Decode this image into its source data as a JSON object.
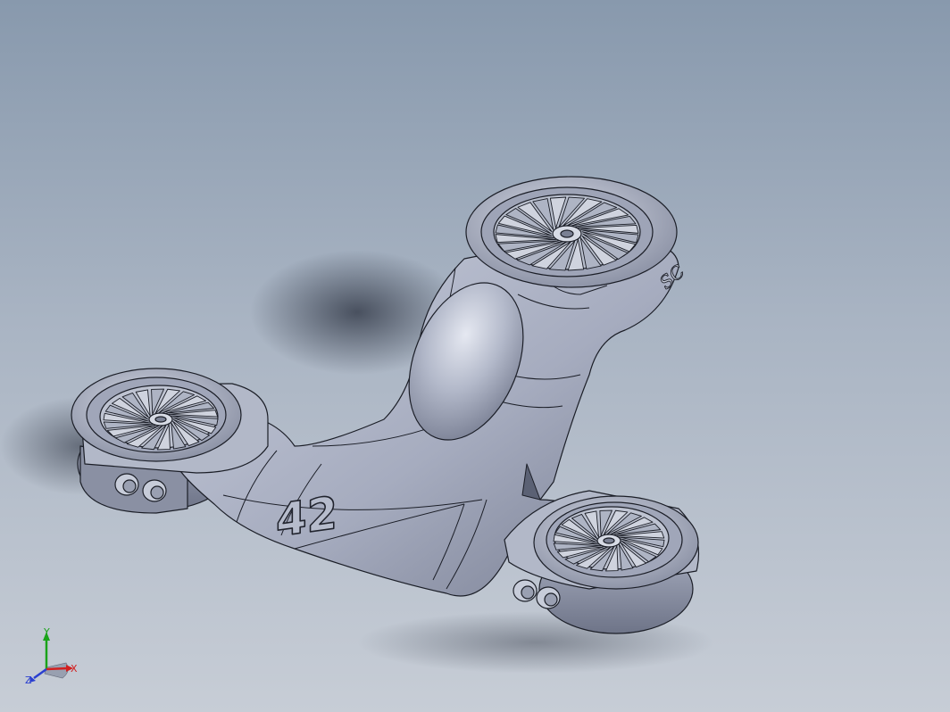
{
  "model": {
    "part_number": "42",
    "side_engraving": "SC",
    "rotor_count": 3,
    "sensor_pairs": 2
  },
  "triad": {
    "x_label": "X",
    "y_label": "Y",
    "z_label": "Z"
  },
  "colors": {
    "background_top": "#8899ad",
    "background_bottom": "#c7cdd6",
    "part_light": "#c9cede",
    "part_mid": "#a2a8bb",
    "part_dark": "#6f7589",
    "x_axis": "#d22020",
    "y_axis": "#1aa31a",
    "z_axis": "#2a3fd0"
  }
}
